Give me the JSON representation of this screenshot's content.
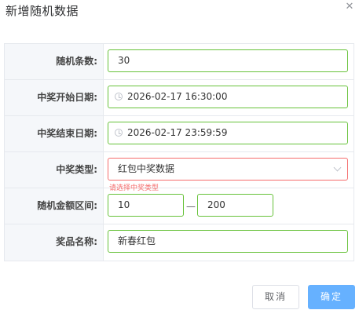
{
  "dialog": {
    "title": "新增随机数据",
    "close_icon": "close-icon"
  },
  "form": {
    "count": {
      "label": "随机条数:",
      "value": "30"
    },
    "start_date": {
      "label": "中奖开始日期:",
      "value": "2026-02-17 16:30:00",
      "icon": "clock-icon"
    },
    "end_date": {
      "label": "中奖结束日期:",
      "value": "2026-02-17 23:59:59",
      "icon": "clock-icon"
    },
    "prize_type": {
      "label": "中奖类型:",
      "value": "红包中奖数据",
      "error": "请选择中奖类型",
      "icon": "chevron-down-icon"
    },
    "amount_range": {
      "label": "随机金额区间:",
      "min": "10",
      "separator": "—",
      "max": "200"
    },
    "prize_name": {
      "label": "奖品名称:",
      "value": "新春红包"
    }
  },
  "footer": {
    "cancel_label": "取消",
    "ok_label": "确定"
  },
  "colors": {
    "valid_border": "#67c23a",
    "error": "#f56c6c",
    "primary": "#66b1ff",
    "label_bg": "#f5f7fa"
  }
}
